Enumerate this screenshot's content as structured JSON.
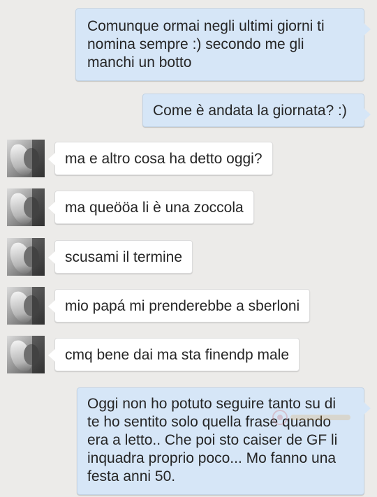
{
  "conversation": {
    "messages": [
      {
        "direction": "outgoing",
        "text": "Comunque ormai negli ultimi giorni ti nomina sempre :) secondo me gli manchi un botto"
      },
      {
        "direction": "outgoing",
        "text": "Come è andata la giornata? :)"
      },
      {
        "direction": "incoming",
        "text": "ma e altro cosa ha detto oggi?"
      },
      {
        "direction": "incoming",
        "text": "ma queööa li è una zoccola"
      },
      {
        "direction": "incoming",
        "text": "scusami il termine"
      },
      {
        "direction": "incoming",
        "text": "mio papá mi prenderebbe a sberloni"
      },
      {
        "direction": "incoming",
        "text": "cmq bene dai ma sta finendp male"
      },
      {
        "direction": "outgoing",
        "text": "Oggi non ho potuto seguire tanto su di te ho sentito solo quella frase quando era a letto.. Che poi sto caiser de GF li inquadra proprio poco... Mo fanno una festa anni 50."
      }
    ]
  },
  "colors": {
    "background": "#ecebe9",
    "outgoing_bubble": "#d6e6f7",
    "incoming_bubble": "#ffffff",
    "text": "#252525"
  },
  "icons": {
    "contact_avatar": "avatar"
  }
}
